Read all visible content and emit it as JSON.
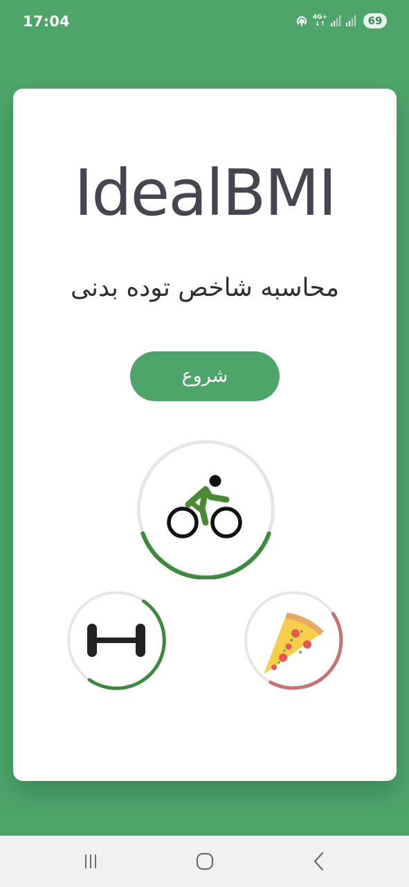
{
  "status_bar": {
    "time": "17:04",
    "network_label_top": "4G+",
    "network_label_bottom": "↓↑",
    "battery": "69",
    "icons": [
      "hotspot-icon",
      "signal-icon",
      "signal-icon",
      "battery-icon"
    ]
  },
  "app": {
    "title": "IdealBMI",
    "subtitle": "محاسبه شاخص توده بدنی",
    "start_button": "شروع"
  },
  "rings": [
    {
      "name": "bike",
      "icon": "bicycle-icon",
      "progress_color": "#3d8a3f"
    },
    {
      "name": "dumbbell",
      "icon": "dumbbell-icon",
      "progress_color": "#3d8a3f"
    },
    {
      "name": "pizza",
      "icon": "pizza-icon",
      "progress_color": "#c97272"
    }
  ],
  "nav_bar": {
    "icons": [
      "recent-apps-icon",
      "home-icon",
      "back-icon"
    ]
  },
  "colors": {
    "background": "#4ea56a",
    "card": "#ffffff",
    "title": "#464650",
    "button": "#4ea56a",
    "ring_track": "#e5e5e5"
  }
}
